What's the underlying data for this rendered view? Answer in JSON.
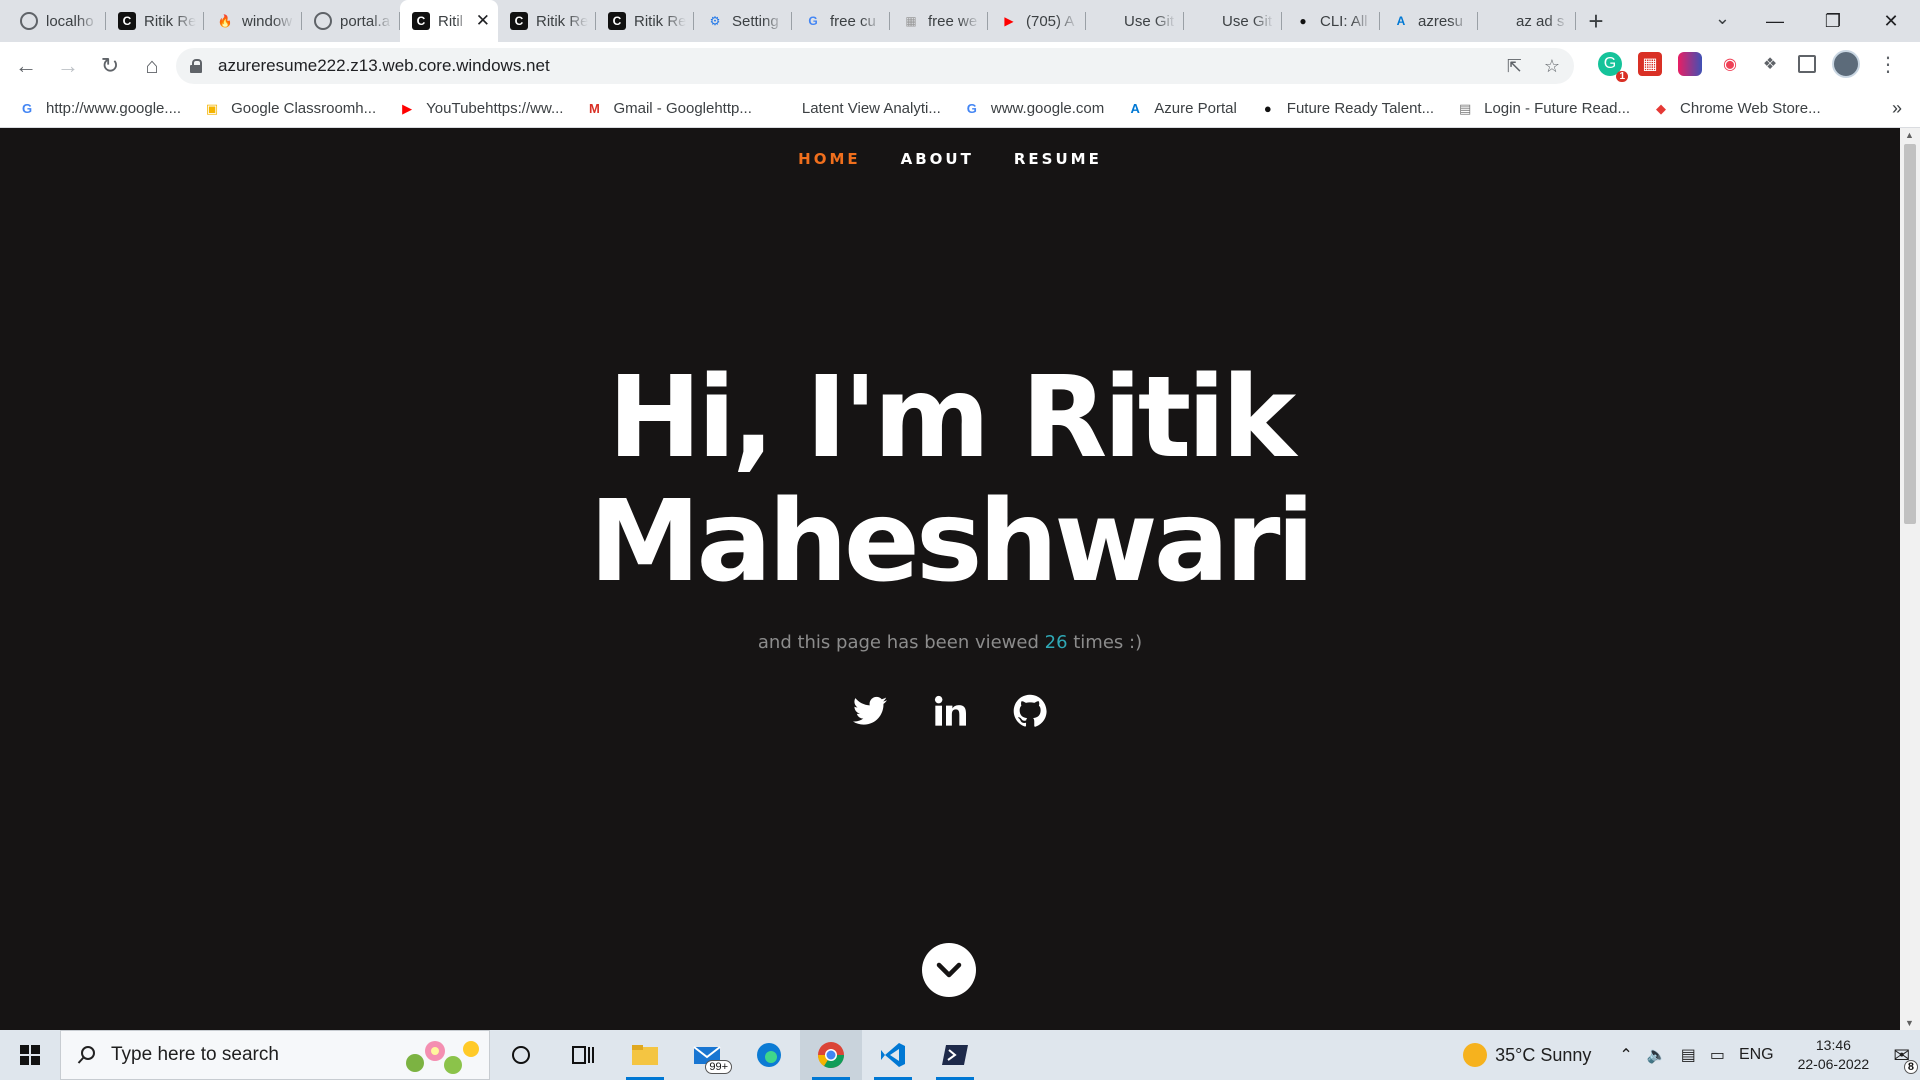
{
  "browser": {
    "tabs": [
      {
        "label": "localho",
        "favicon": "globe-icon"
      },
      {
        "label": "Ritik Re",
        "favicon": "c-logo-icon"
      },
      {
        "label": "window",
        "favicon": "fire-icon"
      },
      {
        "label": "portal.a",
        "favicon": "globe-icon"
      },
      {
        "label": "Ritil",
        "favicon": "c-logo-icon",
        "active": true
      },
      {
        "label": "Ritik Re",
        "favicon": "c-logo-icon"
      },
      {
        "label": "Ritik Re",
        "favicon": "c-logo-icon"
      },
      {
        "label": "Setting",
        "favicon": "gear-icon"
      },
      {
        "label": "free cu",
        "favicon": "google-icon"
      },
      {
        "label": "free we",
        "favicon": "image-icon"
      },
      {
        "label": "(705) A",
        "favicon": "youtube-icon"
      },
      {
        "label": "Use Git",
        "favicon": "microsoft-icon"
      },
      {
        "label": "Use Git",
        "favicon": "microsoft-icon"
      },
      {
        "label": "CLI: All",
        "favicon": "github-icon"
      },
      {
        "label": "azresu",
        "favicon": "azure-icon"
      },
      {
        "label": "az ad s",
        "favicon": "microsoft-icon"
      }
    ],
    "url": "azureresume222.z13.web.core.windows.net",
    "bookmarks": [
      {
        "label": "http://www.google....",
        "icon": "google-icon"
      },
      {
        "label": "Google Classroomh...",
        "icon": "classroom-icon"
      },
      {
        "label": "YouTubehttps://ww...",
        "icon": "youtube-icon"
      },
      {
        "label": "Gmail - Googlehttp...",
        "icon": "gmail-icon"
      },
      {
        "label": "Latent View Analyti...",
        "icon": "globe-icon"
      },
      {
        "label": "www.google.com",
        "icon": "google-icon"
      },
      {
        "label": "Azure Portal",
        "icon": "azure-icon"
      },
      {
        "label": "Future Ready Talent...",
        "icon": "github-icon"
      },
      {
        "label": "Login - Future Read...",
        "icon": "login-icon"
      },
      {
        "label": "Chrome Web Store...",
        "icon": "webstore-icon"
      }
    ],
    "extension_badge": "1"
  },
  "site": {
    "nav": [
      "HOME",
      "ABOUT",
      "RESUME"
    ],
    "hero_line1": "Hi, I'm Ritik",
    "hero_line2": "Maheshwari",
    "subtitle_before": "and this page has been viewed ",
    "view_count": "26",
    "subtitle_after": " times :)",
    "social": [
      "twitter-icon",
      "linkedin-icon",
      "github-icon"
    ],
    "accent_nav": "#f06f1d",
    "accent_count": "#2fa8b5",
    "background": "#161414"
  },
  "taskbar": {
    "search_placeholder": "Type here to search",
    "mail_badge": "99+",
    "weather": "35°C  Sunny",
    "language": "ENG",
    "time": "13:46",
    "date": "22-06-2022",
    "notification_count": "8"
  }
}
